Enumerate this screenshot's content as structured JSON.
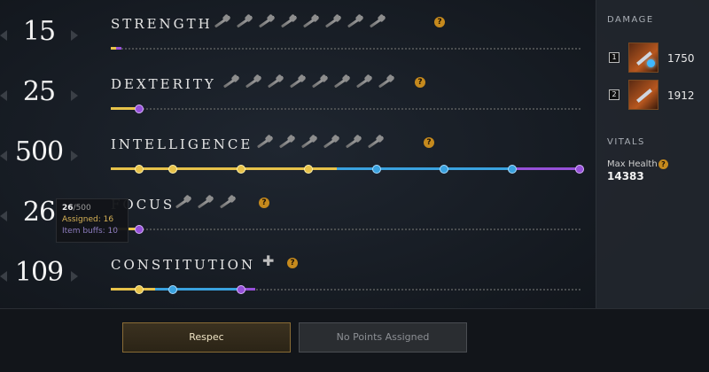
{
  "attributes": [
    {
      "value": "15",
      "name": "STRENGTH",
      "weapon_icons": [
        "great-axe-icon",
        "war-hammer-icon",
        "hatchet-icon",
        "rifle-icon",
        "sword-icon",
        "shield-icon",
        "hatchet-icon",
        "spear-icon"
      ],
      "help": "?",
      "fill_fraction": 0.03,
      "fill_color": "#9650d8"
    },
    {
      "value": "25",
      "name": "DEXTERITY",
      "weapon_icons": [
        "bow-icon",
        "rifle-icon",
        "spear-icon",
        "spear-icon",
        "rapier-icon",
        "hatchet-icon",
        "sword-icon",
        "rapier-icon"
      ],
      "help": "?",
      "fill_fraction": 0.05,
      "fill_color": "#e7c24a"
    },
    {
      "value": "500",
      "name": "INTELLIGENCE",
      "weapon_icons": [
        "fire-staff-icon",
        "fire-staff-icon",
        "void-gauntlet-icon",
        "rapier-icon",
        "spear-icon",
        "ice-gauntlet-icon"
      ],
      "help": "?",
      "fill_fraction": 1.0,
      "fill_color": "#9650d8"
    },
    {
      "value": "26",
      "name": "FOCUS",
      "weapon_icons": [
        "life-staff-icon",
        "void-gauntlet-icon",
        "ice-gauntlet-icon"
      ],
      "help": "?",
      "fill_fraction": 0.052,
      "fill_color": "#9650d8"
    },
    {
      "value": "109",
      "name": "CONSTITUTION",
      "weapon_icons": [],
      "plus": "✚",
      "help": "?",
      "fill_fraction": 0.22,
      "fill_color": "#9650d8"
    }
  ],
  "tooltip": {
    "current": "26",
    "max": "/500",
    "assigned": "Assigned: 16",
    "item_buffs": "Item buffs: 10"
  },
  "side_panel": {
    "damage_title": "DAMAGE",
    "damage_slots": [
      {
        "slot": "1",
        "value": "1750"
      },
      {
        "slot": "2",
        "value": "1912"
      }
    ],
    "vitals_title": "VITALS",
    "max_health_label": "Max Health",
    "max_health_value": "14383",
    "help": "?"
  },
  "buttons": {
    "respec": "Respec",
    "no_points": "No Points Assigned"
  },
  "colors": {
    "gold": "#e7c24a",
    "blue": "#3aa2df",
    "purple": "#9650d8",
    "help_orange": "#c68a1d"
  }
}
